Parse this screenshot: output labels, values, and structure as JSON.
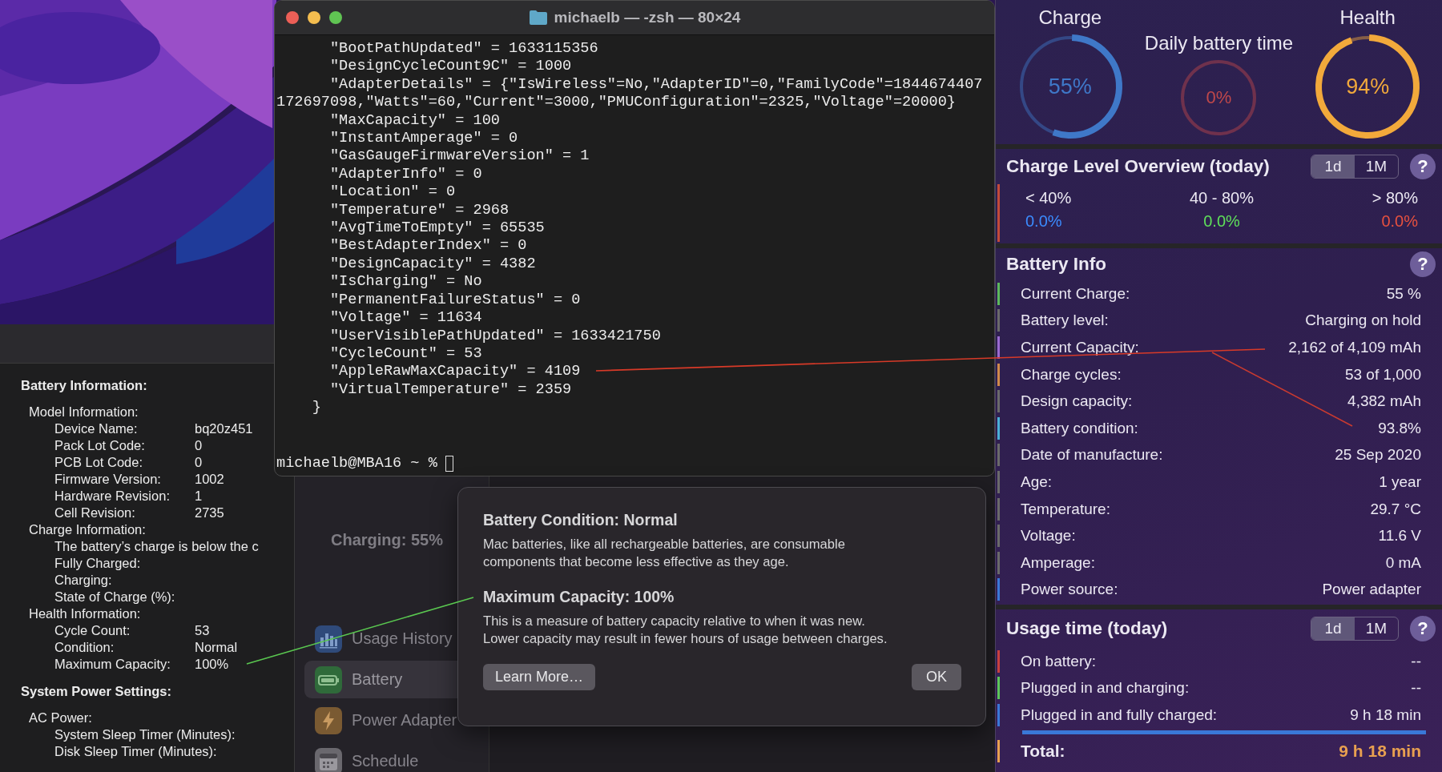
{
  "system_information": {
    "sections": [
      {
        "title": "Battery Information:",
        "items": [
          {
            "label": "Model Information:",
            "children": [
              {
                "label": "Device Name:",
                "value": "bq20z451"
              },
              {
                "label": "Pack Lot Code:",
                "value": "0"
              },
              {
                "label": "PCB Lot Code:",
                "value": "0"
              },
              {
                "label": "Firmware Version:",
                "value": "1002"
              },
              {
                "label": "Hardware Revision:",
                "value": "1"
              },
              {
                "label": "Cell Revision:",
                "value": "2735"
              }
            ]
          },
          {
            "label": "Charge Information:",
            "children": [
              {
                "label": "The battery’s charge is below the c"
              },
              {
                "label": "Fully Charged:"
              },
              {
                "label": "Charging:"
              },
              {
                "label": "State of Charge (%):"
              }
            ]
          },
          {
            "label": "Health Information:",
            "children": [
              {
                "label": "Cycle Count:",
                "value": "53"
              },
              {
                "label": "Condition:",
                "value": "Normal"
              },
              {
                "label": "Maximum Capacity:",
                "value": "100%"
              }
            ]
          }
        ]
      },
      {
        "title": "System Power Settings:",
        "items": [
          {
            "label": "AC Power:",
            "children": [
              {
                "label": "System Sleep Timer (Minutes):"
              },
              {
                "label": "Disk Sleep Timer (Minutes):"
              }
            ]
          }
        ]
      }
    ]
  },
  "system_preferences": {
    "status": "Charging: 55%",
    "sidebar": [
      {
        "label": "Usage History",
        "kind": "usage",
        "selected": false
      },
      {
        "label": "Battery",
        "kind": "battery",
        "selected": true
      },
      {
        "label": "Power Adapter",
        "kind": "power",
        "selected": false
      },
      {
        "label": "Schedule",
        "kind": "schedule",
        "selected": false
      }
    ]
  },
  "terminal": {
    "title": "michaelb — -zsh — 80×24",
    "lines": [
      "      \"BootPathUpdated\" = 1633115356",
      "      \"DesignCycleCount9C\" = 1000",
      "      \"AdapterDetails\" = {\"IsWireless\"=No,\"AdapterID\"=0,\"FamilyCode\"=1844674407",
      "172697098,\"Watts\"=60,\"Current\"=3000,\"PMUConfiguration\"=2325,\"Voltage\"=20000}",
      "      \"MaxCapacity\" = 100",
      "      \"InstantAmperage\" = 0",
      "      \"GasGaugeFirmwareVersion\" = 1",
      "      \"AdapterInfo\" = 0",
      "      \"Location\" = 0",
      "      \"Temperature\" = 2968",
      "      \"AvgTimeToEmpty\" = 65535",
      "      \"BestAdapterIndex\" = 0",
      "      \"DesignCapacity\" = 4382",
      "      \"IsCharging\" = No",
      "      \"PermanentFailureStatus\" = 0",
      "      \"Voltage\" = 11634",
      "      \"UserVisiblePathUpdated\" = 1633421750",
      "      \"CycleCount\" = 53",
      "      \"AppleRawMaxCapacity\" = 4109",
      "      \"VirtualTemperature\" = 2359",
      "    }"
    ],
    "prompt": "michaelb@MBA16 ~ %"
  },
  "dialog": {
    "sections": [
      {
        "title": "Battery Condition: Normal",
        "text": "Mac batteries, like all rechargeable batteries, are consumable components that become less effective as they age."
      },
      {
        "title": "Maximum Capacity: 100%",
        "text": "This is a measure of battery capacity relative to when it was new. Lower capacity may result in fewer hours of usage between charges."
      }
    ],
    "buttons": [
      {
        "label": "Learn More…",
        "kind": "secondary"
      },
      {
        "label": "OK",
        "kind": "default"
      }
    ]
  },
  "battery_monitor": {
    "gauges": [
      {
        "title": "Charge",
        "reading": "55%",
        "level": 0.55,
        "color": "#3f78c8"
      },
      {
        "title": "Daily battery time",
        "reading": "0%",
        "color": "#c0484a"
      },
      {
        "title": "Health",
        "reading": "94%",
        "level": 0.94,
        "color": "#f2a93b"
      }
    ],
    "charge_level_overview": {
      "title": "Charge Level Overview (today)",
      "periods": [
        {
          "label": "1d",
          "selected": true
        },
        {
          "label": "1M",
          "selected": false
        }
      ],
      "help": "?",
      "ranges": [
        {
          "label": "< 40%",
          "value": "0.0%",
          "color": "#3b8cff"
        },
        {
          "label": "40 - 80%",
          "value": "0.0%",
          "color": "#5fe05a"
        },
        {
          "label": "> 80%",
          "value": "0.0%",
          "color": "#e8513f"
        }
      ]
    },
    "battery_info": {
      "title": "Battery Info",
      "help": "?",
      "rows": [
        {
          "label": "Current Charge:",
          "value": "55 %",
          "color": "#5cb85c"
        },
        {
          "label": "Battery level:",
          "value": "Charging on hold",
          "color": "#6a6a6a"
        },
        {
          "label": "Current Capacity:",
          "value": "2,162 of 4,109 mAh",
          "color": "#9a6ad0"
        },
        {
          "label": "Charge cycles:",
          "value": "53 of 1,000",
          "color": "#d08a4a"
        },
        {
          "label": "Design capacity:",
          "value": "4,382 mAh",
          "color": "#6a6a6a"
        },
        {
          "label": "Battery condition:",
          "value": "93.8%",
          "color": "#4ab0d8"
        },
        {
          "label": "Date of manufacture:",
          "value": "25 Sep 2020",
          "color": "#6a6a6a"
        },
        {
          "label": "Age:",
          "value": "1 year",
          "color": "#6a6a6a"
        },
        {
          "label": "Temperature:",
          "value": "29.7 °C",
          "color": "#6a6a6a"
        },
        {
          "label": "Voltage:",
          "value": "11.6 V",
          "color": "#6a6a6a"
        },
        {
          "label": "Amperage:",
          "value": "0 mA",
          "color": "#6a6a6a"
        },
        {
          "label": "Power source:",
          "value": "Power adapter",
          "color": "#3a78d8"
        }
      ]
    },
    "usage_time": {
      "title": "Usage time (today)",
      "periods": [
        {
          "label": "1d",
          "selected": true
        },
        {
          "label": "1M",
          "selected": false
        }
      ],
      "help": "?",
      "rows": [
        {
          "label": "On battery:",
          "value": "--",
          "color": "#c8403f",
          "level": 0
        },
        {
          "label": "Plugged in and charging:",
          "value": "--",
          "color": "#5cc65a",
          "level": 0
        },
        {
          "label": "Plugged in and fully charged:",
          "value": "9 h 18 min",
          "color": "#3a78d8",
          "level": 1
        }
      ],
      "total": {
        "label": "Total:",
        "value": "9 h 18 min",
        "color": "#e8a050"
      }
    }
  }
}
